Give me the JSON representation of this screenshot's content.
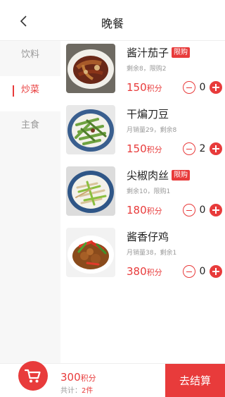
{
  "header": {
    "title": "晚餐"
  },
  "sidebar": {
    "items": [
      {
        "label": "饮料"
      },
      {
        "label": "炒菜",
        "active": true
      },
      {
        "label": "主食"
      }
    ]
  },
  "dishes": [
    {
      "name": "酱汁茄子",
      "badge": "限购",
      "meta": "剩余8，限购2",
      "price": "150",
      "unit": "积分",
      "qty": "0"
    },
    {
      "name": "干煸刀豆",
      "badge": "",
      "meta": "月销量29，剩余8",
      "price": "150",
      "unit": "积分",
      "qty": "2"
    },
    {
      "name": "尖椒肉丝",
      "badge": "限购",
      "meta": "剩余10，限购1",
      "price": "180",
      "unit": "积分",
      "qty": "0"
    },
    {
      "name": "酱香仔鸡",
      "badge": "",
      "meta": "月销量38，剩余1",
      "price": "380",
      "unit": "积分",
      "qty": "0"
    }
  ],
  "footer": {
    "total": "300",
    "total_unit": "积分",
    "count_prefix": "共计：",
    "count_value": "2件",
    "checkout_label": "去结算"
  },
  "colors": {
    "accent": "#e83b3b",
    "muted": "#999999",
    "sidebar_bg": "#f7f7f7"
  },
  "icons": {
    "back": "chevron-left-icon",
    "cart": "shopping-cart-icon"
  }
}
